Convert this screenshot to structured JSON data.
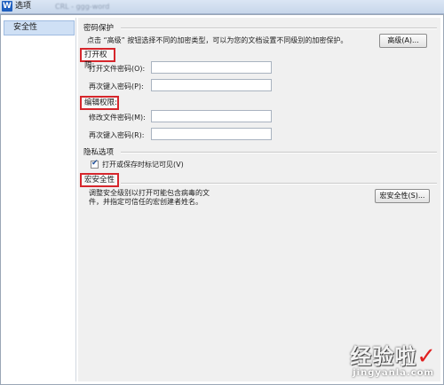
{
  "window": {
    "title": "选项",
    "app_icon_letter": "W",
    "blurred_title": "CRL - ggg-word"
  },
  "sidebar": {
    "items": [
      {
        "label": "安全性",
        "selected": true
      }
    ]
  },
  "password_section": {
    "title": "密码保护",
    "description": "点击 “高级” 按钮选择不同的加密类型，可以为您的文档设置不同级别的加密保护。",
    "advanced_button": "高级(A)...",
    "open_permission": {
      "title": "打开权限:",
      "fields": [
        {
          "label": "打开文件密码(O):",
          "value": ""
        },
        {
          "label": "再次键入密码(P):",
          "value": ""
        }
      ]
    },
    "edit_permission": {
      "title": "编辑权限:",
      "fields": [
        {
          "label": "修改文件密码(M):",
          "value": ""
        },
        {
          "label": "再次键入密码(R):",
          "value": ""
        }
      ]
    }
  },
  "privacy_section": {
    "title": "隐私选项",
    "checkbox_label": "打开或保存时标记可见(V)",
    "checked": true
  },
  "macro_section": {
    "title": "宏安全性",
    "description_line1": "调整安全级别以打开可能包含病毒的文",
    "description_line2": "件，并指定可信任的宏创建者姓名。",
    "button": "宏安全性(S)..."
  },
  "watermark": {
    "main": "经验啦",
    "check": "✓",
    "url": "jingyanla.com"
  },
  "colors": {
    "highlight_red": "#d6262c",
    "selection": "#cfe0f5"
  }
}
